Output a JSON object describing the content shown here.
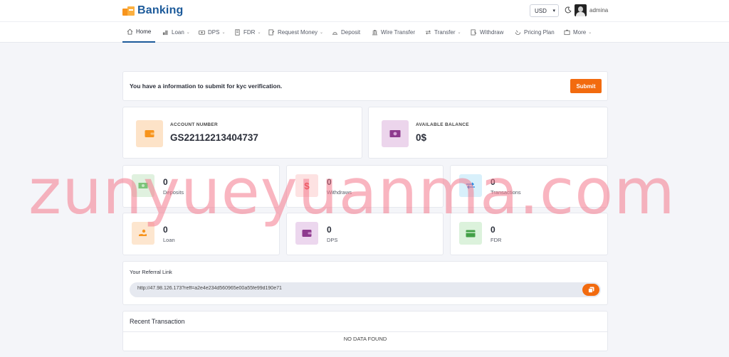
{
  "brand": {
    "name": "Banking"
  },
  "header": {
    "currency": "USD",
    "username": "admina"
  },
  "nav": {
    "items": [
      {
        "label": "Home",
        "icon": "home-icon",
        "caret": false,
        "active": true
      },
      {
        "label": "Loan",
        "icon": "loan-icon",
        "caret": true
      },
      {
        "label": "DPS",
        "icon": "dps-icon",
        "caret": true
      },
      {
        "label": "FDR",
        "icon": "fdr-icon",
        "caret": true
      },
      {
        "label": "Request Money",
        "icon": "request-money-icon",
        "caret": true
      },
      {
        "label": "Deposit",
        "icon": "deposit-icon",
        "caret": false
      },
      {
        "label": "Wire Transfer",
        "icon": "bank-icon",
        "caret": false
      },
      {
        "label": "Transfer",
        "icon": "transfer-icon",
        "caret": true
      },
      {
        "label": "Withdraw",
        "icon": "withdraw-icon",
        "caret": false
      },
      {
        "label": "Pricing Plan",
        "icon": "pricing-icon",
        "caret": false
      },
      {
        "label": "More",
        "icon": "more-icon",
        "caret": true
      }
    ]
  },
  "kyc": {
    "message": "You have a information to submit for kyc verification.",
    "submit_label": "Submit"
  },
  "account": {
    "label": "ACCOUNT NUMBER",
    "value": "GS22112213404737"
  },
  "balance": {
    "label": "AVAILABLE BALANCE",
    "value": "0$"
  },
  "stats": [
    {
      "value": "0",
      "label": "Deposits",
      "icon": "cash-icon",
      "color": "#4caf50",
      "bg": "#e3f4e3"
    },
    {
      "value": "0",
      "label": "Withdraws",
      "icon": "dollar-icon",
      "color": "#e53935",
      "bg": "#fde4e4"
    },
    {
      "value": "0",
      "label": "Transactions",
      "icon": "exchange-icon",
      "color": "#1e88e5",
      "bg": "#dcf1fb"
    },
    {
      "value": "0",
      "label": "Loan",
      "icon": "hand-coin-icon",
      "color": "#f7941d",
      "bg": "#fde9d3"
    },
    {
      "value": "0",
      "label": "DPS",
      "icon": "wallet-icon",
      "color": "#8e3b8e",
      "bg": "#eedcf0"
    },
    {
      "value": "0",
      "label": "FDR",
      "icon": "card-icon",
      "color": "#43a047",
      "bg": "#dff3df"
    }
  ],
  "referral": {
    "title": "Your Referral Link",
    "link": "http://47.98.126.173?reff=a2e4e234d560965e00a55fe99d190e71"
  },
  "recent": {
    "title": "Recent Transaction",
    "empty": "NO DATA FOUND"
  },
  "watermark": "zunyueyuanma.com",
  "colors": {
    "accent": "#f26b0f",
    "brand": "#1c5a9a"
  }
}
